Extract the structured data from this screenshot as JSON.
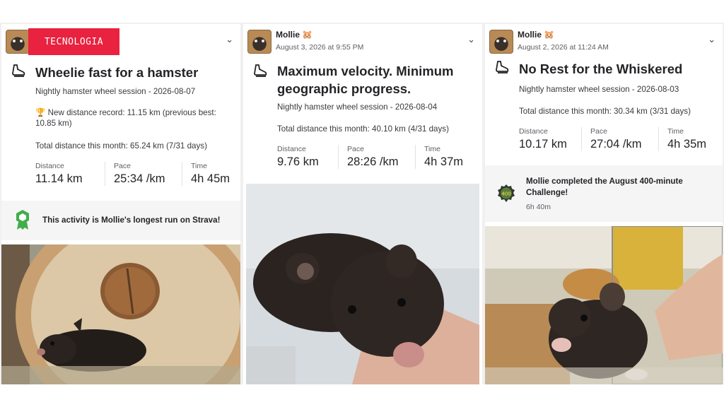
{
  "overlay": {
    "tag": "TECNOLOGIA"
  },
  "cards": [
    {
      "title": "Wheelie fast for a hamster",
      "session": "Nightly hamster wheel session - 2026-08-07",
      "record": "🏆 New distance record: 11.15 km (previous best: 10.85 km)",
      "month_total": "Total distance this month: 65.24 km (7/31 days)",
      "stats": [
        {
          "label": "Distance",
          "value": "11.14 km"
        },
        {
          "label": "Pace",
          "value": "25:34 /km"
        },
        {
          "label": "Time",
          "value": "4h 45m"
        }
      ],
      "banner": "This activity is Mollie's longest run on Strava!"
    },
    {
      "user": "Mollie 🐹",
      "date": "August 3, 2026 at 9:55 PM",
      "title": "Maximum velocity. Minimum geographic progress.",
      "session": "Nightly hamster wheel session - 2026-08-04",
      "month_total": "Total distance this month: 40.10 km (4/31 days)",
      "stats": [
        {
          "label": "Distance",
          "value": "9.76 km"
        },
        {
          "label": "Pace",
          "value": "28:26 /km"
        },
        {
          "label": "Time",
          "value": "4h 37m"
        }
      ]
    },
    {
      "user": "Mollie 🐹",
      "date": "August 2, 2026 at 11:24 AM",
      "title": "No Rest for the Whiskered",
      "session": "Nightly hamster wheel session - 2026-08-03",
      "month_total": "Total distance this month: 30.34 km (3/31 days)",
      "stats": [
        {
          "label": "Distance",
          "value": "10.17 km"
        },
        {
          "label": "Pace",
          "value": "27:04 /km"
        },
        {
          "label": "Time",
          "value": "4h 35m"
        }
      ],
      "challenge": {
        "badge": "400",
        "text": "Mollie completed the August 400-minute Challenge!",
        "duration": "6h 40m"
      }
    }
  ],
  "icons": {
    "shoe": "running-shoe-icon",
    "chevron": "chevron-down-icon",
    "achievement": "achievement-badge-icon",
    "challenge": "challenge-badge-icon"
  },
  "colors": {
    "tag_bg": "#e8223f",
    "achievement_green": "#3fae49"
  }
}
